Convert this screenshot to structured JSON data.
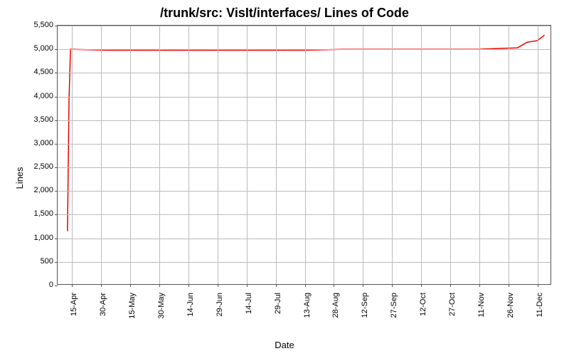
{
  "chart_data": {
    "type": "line",
    "title": "/trunk/src: VisIt/interfaces/ Lines of Code",
    "xlabel": "Date",
    "ylabel": "Lines",
    "ylim": [
      0,
      5500
    ],
    "y_ticks": [
      0,
      500,
      1000,
      1500,
      2000,
      2500,
      3000,
      3500,
      4000,
      4500,
      5000,
      5500
    ],
    "y_tick_labels": [
      "0",
      "500",
      "1,000",
      "1,500",
      "2,000",
      "2,500",
      "3,000",
      "3,500",
      "4,000",
      "4,500",
      "5,000",
      "5,500"
    ],
    "x_tick_labels": [
      "15-Apr",
      "30-Apr",
      "15-May",
      "30-May",
      "14-Jun",
      "29-Jun",
      "14-Jul",
      "29-Jul",
      "13-Aug",
      "28-Aug",
      "12-Sep",
      "27-Sep",
      "12-Oct",
      "27-Oct",
      "11-Nov",
      "26-Nov",
      "11-Dec"
    ],
    "series": [
      {
        "name": "Lines of Code",
        "color": "#ee0000",
        "points": [
          {
            "x_frac": 0.02,
            "y": 1150
          },
          {
            "x_frac": 0.023,
            "y": 3900
          },
          {
            "x_frac": 0.026,
            "y": 5000
          },
          {
            "x_frac": 0.1,
            "y": 4980
          },
          {
            "x_frac": 0.2,
            "y": 4980
          },
          {
            "x_frac": 0.3,
            "y": 4980
          },
          {
            "x_frac": 0.4,
            "y": 4980
          },
          {
            "x_frac": 0.5,
            "y": 4980
          },
          {
            "x_frac": 0.575,
            "y": 5000
          },
          {
            "x_frac": 0.65,
            "y": 5000
          },
          {
            "x_frac": 0.75,
            "y": 5000
          },
          {
            "x_frac": 0.85,
            "y": 5000
          },
          {
            "x_frac": 0.9,
            "y": 5020
          },
          {
            "x_frac": 0.93,
            "y": 5030
          },
          {
            "x_frac": 0.95,
            "y": 5150
          },
          {
            "x_frac": 0.97,
            "y": 5180
          },
          {
            "x_frac": 0.985,
            "y": 5300
          }
        ]
      }
    ]
  }
}
